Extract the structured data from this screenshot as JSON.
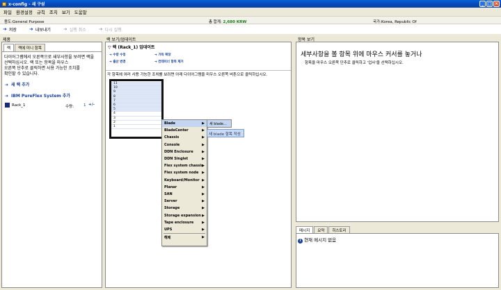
{
  "window": {
    "title": "x-config - 새 구성"
  },
  "menubar": [
    "파일",
    "환경설정",
    "규칙",
    "조치",
    "보기",
    "도움말"
  ],
  "infobar": {
    "usage_label": "용도:",
    "usage_value": "General Purpose",
    "total_label": "총 합계:",
    "total_value": "2,680 KRW",
    "country_label": "국가:",
    "country_value": "Korea, Republic Of"
  },
  "toolbar": {
    "save": "저장",
    "export": "내보내기",
    "undo": "실행 취소",
    "redo": "다시 실행"
  },
  "left_panel": {
    "title": "제품",
    "tabs": [
      "랙",
      "랙에 미니 항목"
    ],
    "instructions": [
      "다이어그램에서 오른쪽으로 새부사항을 보려면 랙을",
      "선택하십시오. 랙 또는 항목을 마우스",
      "오른쪽 단추로 클릭하면 사용 가능한 조치를",
      "확인할 수 있습니다."
    ],
    "add_rack": "새 랙 추가",
    "add_pureflex": "IBM PureFlex System 추가",
    "rack_name": "Rack_1",
    "qty_label": "수량:",
    "qty_value": "1"
  },
  "center_panel": {
    "title": "랙 보기/업데이트",
    "subtitle": "랙 (Rack_1) 업데이트",
    "actions": [
      "수량 수정",
      "가득 확장",
      "출산 변경",
      "컨테이너 항목 제거"
    ],
    "hint": "각 항목에 여러 사용 가능한 조치를 보려면 아래 다이어그램을 마우스 오른쪽 버튼으로 클릭하십시오.",
    "rack_units": [
      "11",
      "10",
      "9",
      "8",
      "7",
      "6",
      "5",
      "4",
      "3",
      "2",
      "1"
    ]
  },
  "context_menu": {
    "items": [
      "Blade",
      "BladeCenter",
      "Chassis",
      "Console",
      "DDN Enclosure",
      "DDN Singlet",
      "Flex system chassis",
      "Flex system node",
      "Keyboard/Monitor",
      "Planar",
      "SAN",
      "Server",
      "Storage",
      "Storage expansion",
      "Tape enclosure",
      "UPS",
      "해제"
    ],
    "submenu_item": "새 blade...",
    "tooltip": "새 blade 항목 작성"
  },
  "right_panel": {
    "title": "항목 보기",
    "heading": "세부사항을 볼 항목 위에 마우스 커서를 놓거나",
    "subtext": "항목을 마우스 오른쪽 단추로 클릭하고 '업사'을 선택하십시오."
  },
  "messages": {
    "tabs": [
      "메시지",
      "요약",
      "히스토리"
    ],
    "empty": "현재 메시지 없음"
  }
}
